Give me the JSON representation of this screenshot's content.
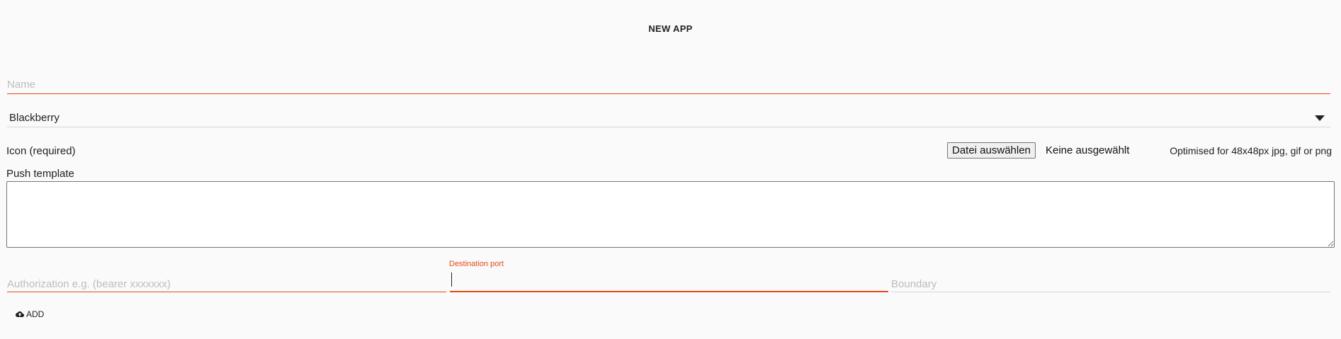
{
  "header": {
    "title": "NEW APP"
  },
  "form": {
    "name": {
      "placeholder": "Name",
      "value": ""
    },
    "platform": {
      "selected": "Blackberry"
    },
    "icon": {
      "label": "Icon (required)",
      "choose_button": "Datei auswählen",
      "file_status": "Keine ausgewählt",
      "hint": "Optimised for 48x48px jpg, gif or png"
    },
    "push_template": {
      "label": "Push template",
      "value": ""
    },
    "authorization": {
      "placeholder": "Authorization e.g. (bearer xxxxxxx)",
      "value": ""
    },
    "destination_port": {
      "label": "Destination port",
      "value": ""
    },
    "boundary": {
      "placeholder": "Boundary",
      "value": ""
    }
  },
  "actions": {
    "add_label": "ADD",
    "add_icon": "cloud-upload-icon"
  },
  "colors": {
    "accent": "#e64a19",
    "background": "#fafafa",
    "placeholder": "#bdbdbd"
  }
}
